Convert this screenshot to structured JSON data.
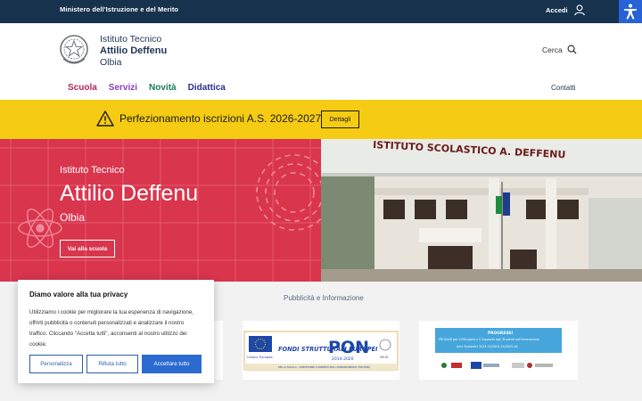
{
  "topbar": {
    "ministry": "Ministero dell'Istruzione e del Merito",
    "login": "Accedi"
  },
  "header": {
    "line1": "Istituto Tecnico",
    "line2": "Attilio Deffenu",
    "line3": "Olbia",
    "search": "Cerca",
    "contacts": "Contatti"
  },
  "nav": [
    {
      "label": "Scuola",
      "color": "#b5275c"
    },
    {
      "label": "Servizi",
      "color": "#8b3dbf"
    },
    {
      "label": "Novità",
      "color": "#1b7a5a"
    },
    {
      "label": "Didattica",
      "color": "#2c2e8f"
    }
  ],
  "alert": {
    "message": "Perfezionamento iscrizioni A.S. 2026-2027",
    "button": "Dettagli"
  },
  "hero": {
    "kicker": "Istituto Tecnico",
    "title": "Attilio Deffenu",
    "city": "Olbia",
    "button": "Vai alla scuola"
  },
  "photo": {
    "sign": "ISTITUTO  SCOLASTICO  A.  DEFFENU"
  },
  "publicity": {
    "title": "Pubblicità e Informazione"
  },
  "pon_card": {
    "eu": "Unione Europea",
    "fondi": "FONDI STRUTTURALI EUROPEI",
    "pon": "PON",
    "years": "2014-2020",
    "min": "MIUR",
    "foot": "PER LA SCUOLA - COMPETENZE E AMBIENTI PER L'APPRENDIMENTO (FSE-FESR)"
  },
  "progress_card": {
    "head": "PROGRESSI",
    "line1": "PROGetti per il REcupero e il Supporto agli Studenti nell'Innovazione",
    "line2": "Anni Scolastici 2023-24/2024-25/2025-26"
  },
  "cookie": {
    "title": "Diamo valore alla tua privacy",
    "body": "Utilizziamo i cookie per migliorare la tua esperienza di navigazione, offrirti pubblicità o contenuti personalizzati e analizzare il nostro traffico. Cliccando \"Accetta tutti\", acconsenti al nostro utilizzo dei cookie.",
    "customize": "Personalizza",
    "reject": "Rifiuta tutto",
    "accept": "Accettare tutto"
  },
  "colors": {
    "topbar": "#17324d",
    "alert": "#f5cc13",
    "hero": "#d9354d",
    "accent": "#2b6bd0"
  }
}
